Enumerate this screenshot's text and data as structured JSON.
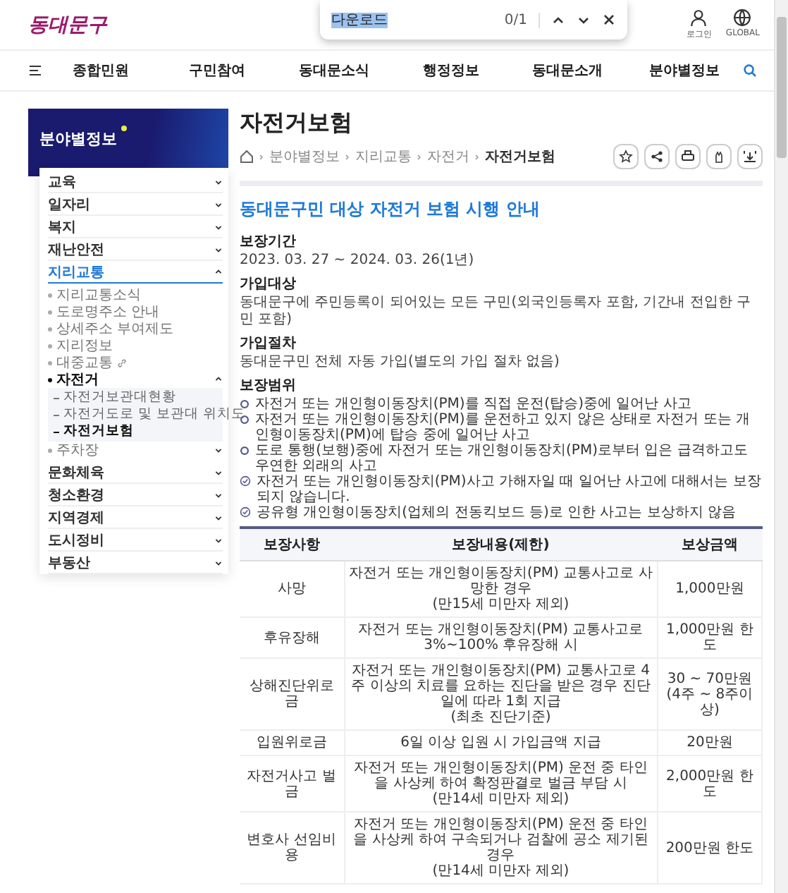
{
  "header": {
    "logo": "동대문구",
    "login": "로그인",
    "global": "GLOBAL"
  },
  "find_bar": {
    "value": "다운로드",
    "count": "0/1"
  },
  "nav": [
    "종합민원",
    "구민참여",
    "동대문소식",
    "행정정보",
    "동대문소개",
    "분야별정보"
  ],
  "sidebar": {
    "title": "분야별정보",
    "items": [
      {
        "label": "교육",
        "expanded": false,
        "selected": false
      },
      {
        "label": "일자리",
        "expanded": false,
        "selected": false
      },
      {
        "label": "복지",
        "expanded": false,
        "selected": false
      },
      {
        "label": "재난안전",
        "expanded": false,
        "selected": false
      },
      {
        "label": "지리교통",
        "expanded": true,
        "selected": true,
        "children": [
          {
            "label": "지리교통소식",
            "external": false,
            "selected": false
          },
          {
            "label": "도로명주소 안내",
            "external": false,
            "selected": false
          },
          {
            "label": "상세주소 부여제도",
            "external": false,
            "selected": false
          },
          {
            "label": "지리정보",
            "external": false,
            "selected": false
          },
          {
            "label": "대중교통",
            "external": true,
            "selected": false
          },
          {
            "label": "자전거",
            "external": false,
            "selected": true,
            "expanded": true,
            "children": [
              {
                "label": "자전거보관대현황",
                "selected": false
              },
              {
                "label": "자전거도로 및 보관대 위치도",
                "selected": false
              },
              {
                "label": "자전거보험",
                "selected": true
              }
            ]
          },
          {
            "label": "주차장",
            "external": false,
            "selected": false,
            "expanded": false
          }
        ]
      },
      {
        "label": "문화체육",
        "expanded": false,
        "selected": false
      },
      {
        "label": "청소환경",
        "expanded": false,
        "selected": false
      },
      {
        "label": "지역경제",
        "expanded": false,
        "selected": false
      },
      {
        "label": "도시정비",
        "expanded": false,
        "selected": false
      },
      {
        "label": "부동산",
        "expanded": false,
        "selected": false
      }
    ]
  },
  "page": {
    "title": "자전거보험",
    "breadcrumb": [
      "분야별정보",
      "지리교통",
      "자전거",
      "자전거보험"
    ],
    "heading": "동대문구민 대상 자전거 보험 시행 안내",
    "sections": [
      {
        "title": "보장기간",
        "text": "2023. 03. 27 ~ 2024. 03. 26(1년)"
      },
      {
        "title": "가입대상",
        "text": "동대문구에 주민등록이 되어있는 모든 구민(외국인등록자 포함, 기간내 전입한 구민 포함)"
      },
      {
        "title": "가입절차",
        "text": "동대문구민 전체 자동 가입(별도의 가입 절차 없음)"
      }
    ],
    "coverage_title": "보장범위",
    "coverage": [
      {
        "kind": "circle",
        "text": "자전거 또는 개인형이동장치(PM)를 직접 운전(탑승)중에 일어난 사고"
      },
      {
        "kind": "circle",
        "text": "자전거 또는 개인형이동장치(PM)를 운전하고 있지 않은 상태로 자전거 또는 개인형이동장치(PM)에 탑승 중에 일어난 사고"
      },
      {
        "kind": "circle",
        "text": "도로 통행(보행)중에 자전거 또는 개인형이동장치(PM)로부터 입은 급격하고도 우연한 외래의 사고"
      },
      {
        "kind": "check",
        "text": "자전거 또는 개인형이동장치(PM)사고 가해자일 때 일어난 사고에 대해서는 보장되지 않습니다."
      },
      {
        "kind": "check",
        "text": "공유형 개인형이동장치(업체의 전동킥보드 등)로 인한 사고는 보상하지 않음"
      }
    ],
    "table": {
      "columns": [
        "보장사항",
        "보장내용(제한)",
        "보상금액"
      ],
      "rows": [
        [
          "사망",
          "자전거 또는 개인형이동장치(PM) 교통사고로 사망한 경우\n(만15세 미만자 제외)",
          "1,000만원"
        ],
        [
          "후유장해",
          "자전거 또는 개인형이동장치(PM) 교통사고로 3%~100% 후유장해 시",
          "1,000만원 한도"
        ],
        [
          "상해진단위로금",
          "자전거 또는 개인형이동장치(PM) 교통사고로 4주 이상의 치료를 요하는 진단을 받은 경우 진단일에 따라 1회 지급\n(최초 진단기준)",
          "30 ~ 70만원\n(4주 ~ 8주이상)"
        ],
        [
          "입원위로금",
          "6일 이상 입원 시 가입금액 지급",
          "20만원"
        ],
        [
          "자전거사고 벌금",
          "자전거 또는 개인형이동장치(PM) 운전 중 타인을 사상케 하여 확정판결로 벌금 부담 시\n(만14세 미만자 제외)",
          "2,000만원 한도"
        ],
        [
          "변호사 선임비용",
          "자전거 또는 개인형이동장치(PM) 운전 중 타인을 사상케 하여 구속되거나 검찰에 공소 제기된 경우\n(만14세 미만자 제외)",
          "200만원 한도"
        ]
      ]
    }
  }
}
